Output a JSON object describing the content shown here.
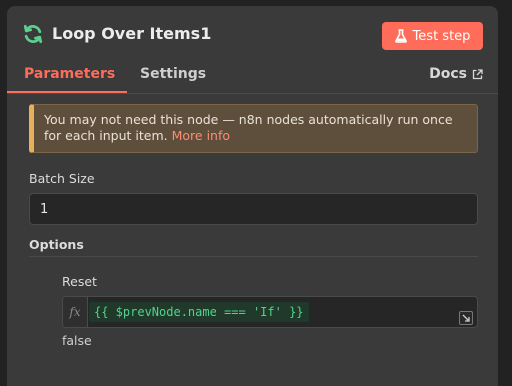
{
  "node": {
    "title": "Loop Over Items1",
    "icon": "loop-arrows-icon",
    "icon_color": "#5ecf8f"
  },
  "header": {
    "test_step_label": "Test step",
    "test_step_icon": "flask-icon",
    "accent_color": "#ff6d5a"
  },
  "tabs": [
    {
      "label": "Parameters",
      "active": true
    },
    {
      "label": "Settings",
      "active": false
    }
  ],
  "docs": {
    "label": "Docs",
    "icon": "external-link-icon"
  },
  "notice": {
    "text": "You may not need this node — n8n nodes automatically run once for each input item.",
    "link_label": "More info",
    "color": "#e6b15a"
  },
  "batch_size": {
    "label": "Batch Size",
    "value": "1"
  },
  "options": {
    "heading": "Options",
    "reset": {
      "label": "Reset",
      "fx_label": "fx",
      "expression": "{{ $prevNode.name === 'If' }}",
      "result": "false",
      "expression_color": "#4fd58b"
    }
  }
}
